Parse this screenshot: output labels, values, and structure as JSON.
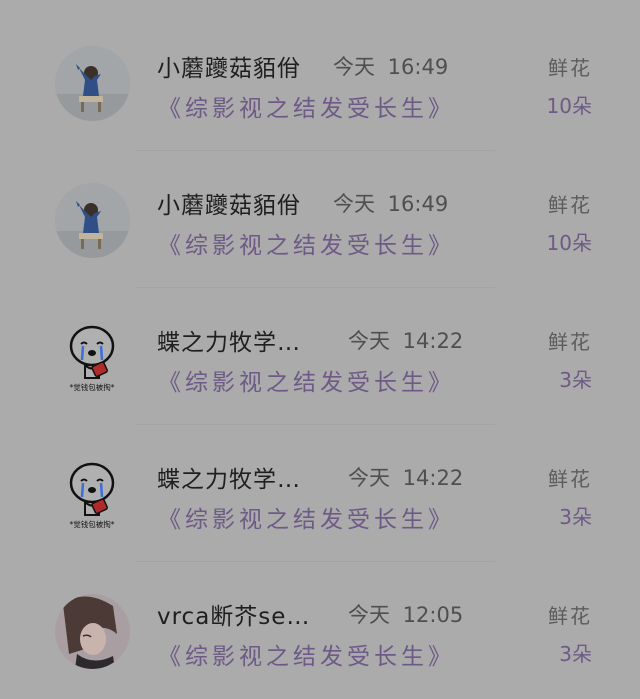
{
  "gift_records": [
    {
      "user": "小蘑躨菇貊佾",
      "time": "今天 16:49",
      "book": "《综影视之结发受长生》",
      "gift_label": "鲜花",
      "gift_count": "10朵",
      "avatar_icon": "photo-avatar-icon"
    },
    {
      "user": "小蘑躨菇貊佾",
      "time": "今天 16:49",
      "book": "《综影视之结发受长生》",
      "gift_label": "鲜花",
      "gift_count": "10朵",
      "avatar_icon": "photo-avatar-icon"
    },
    {
      "user": "蝶之力牧学…",
      "time": "今天 14:22",
      "book": "《综影视之结发受长生》",
      "gift_label": "鲜花",
      "gift_count": "3朵",
      "avatar_icon": "crying-cartoon-avatar-icon",
      "avatar_caption": "*觉钱包被掏*"
    },
    {
      "user": "蝶之力牧学…",
      "time": "今天 14:22",
      "book": "《综影视之结发受长生》",
      "gift_label": "鲜花",
      "gift_count": "3朵",
      "avatar_icon": "crying-cartoon-avatar-icon",
      "avatar_caption": "*觉钱包被掏*"
    },
    {
      "user": "vrca断芥se…",
      "time": "今天 12:05",
      "book": "《综影视之结发受长生》",
      "gift_label": "鲜花",
      "gift_count": "3朵",
      "avatar_icon": "photo-avatar-icon"
    }
  ]
}
